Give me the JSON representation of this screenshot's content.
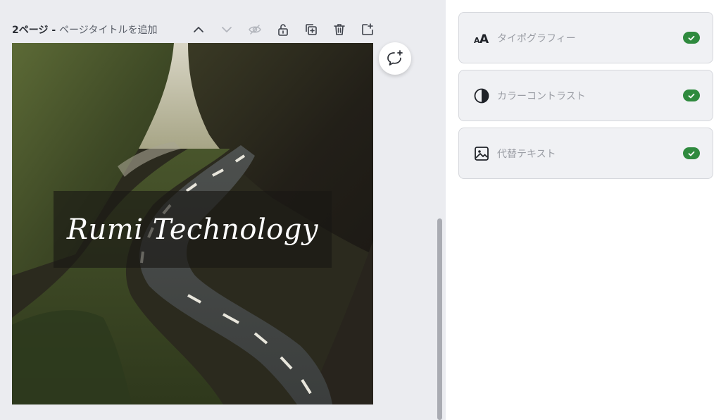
{
  "page_header": {
    "page_number": "2ページ",
    "separator": " - ",
    "add_title_placeholder": "ページタイトルを追加"
  },
  "toolbar": {
    "icons": [
      "chevron-up-icon",
      "chevron-down-icon",
      "hide-icon",
      "lock-icon",
      "duplicate-icon",
      "trash-icon",
      "add-page-icon"
    ]
  },
  "canvas": {
    "title_text": "Rumi Technology"
  },
  "checks": {
    "items": [
      {
        "label": "タイポグラフィー",
        "icon": "typography-icon",
        "status": "passed"
      },
      {
        "label": "カラーコントラスト",
        "icon": "contrast-icon",
        "status": "passed"
      },
      {
        "label": "代替テキスト",
        "icon": "image-icon",
        "status": "passed"
      }
    ]
  },
  "colors": {
    "check_green": "#2f8a3e",
    "editor_bg": "#ebecf0",
    "card_bg": "#f0f1f4"
  }
}
